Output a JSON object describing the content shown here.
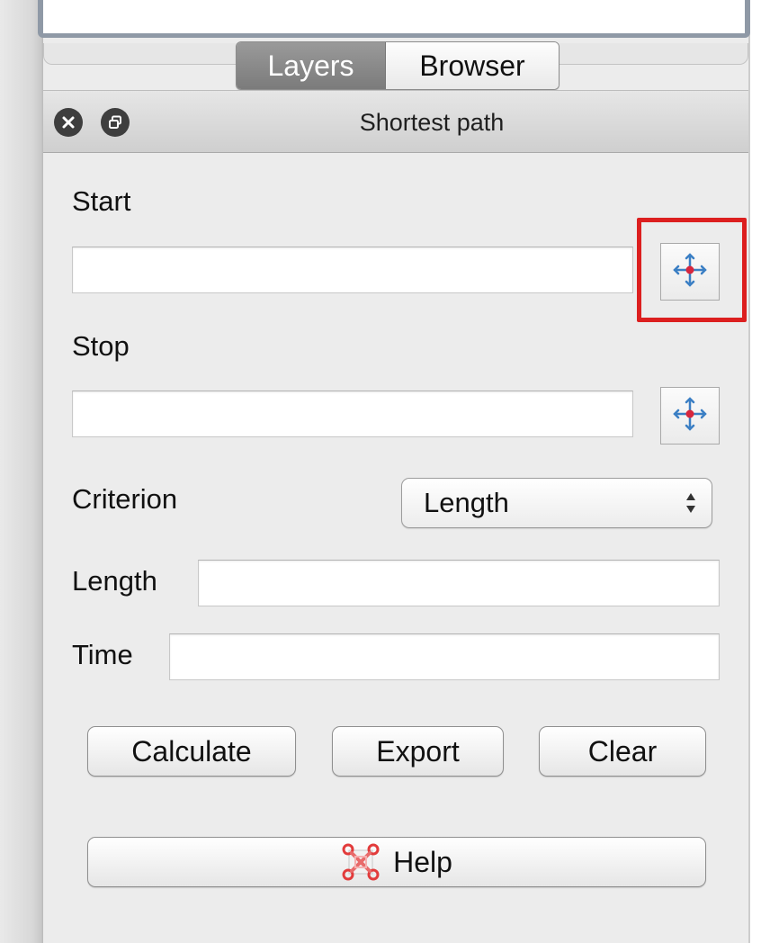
{
  "tabs": [
    {
      "label": "Layers",
      "active": true
    },
    {
      "label": "Browser",
      "active": false
    }
  ],
  "panel": {
    "title": "Shortest path",
    "close_icon": "close-icon",
    "float_icon": "float-icon"
  },
  "start": {
    "label": "Start",
    "value": "",
    "capture_icon": "capture-point-icon"
  },
  "stop": {
    "label": "Stop",
    "value": "",
    "capture_icon": "capture-point-icon"
  },
  "criterion": {
    "label": "Criterion",
    "selected": "Length"
  },
  "length": {
    "label": "Length",
    "value": ""
  },
  "time": {
    "label": "Time",
    "value": ""
  },
  "buttons": {
    "calculate": "Calculate",
    "export": "Export",
    "clear": "Clear",
    "help": "Help"
  },
  "colors": {
    "highlight": "#dc1f1f",
    "active_tab": "#8a8a8a",
    "capture_point": "#d7263d",
    "capture_arrows": "#3b7fc4"
  }
}
